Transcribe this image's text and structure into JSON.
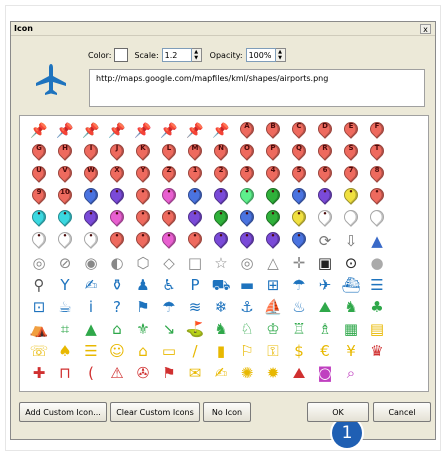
{
  "window": {
    "title": "Icon",
    "close_label": "x"
  },
  "preview": {
    "icon": "airplane-icon",
    "color": "#1e73be"
  },
  "controls": {
    "color_label": "Color:",
    "scale_label": "Scale:",
    "scale_value": "1.2",
    "opacity_label": "Opacity:",
    "opacity_value": "100%"
  },
  "url": "http://maps.google.com/mapfiles/kml/shapes/airports.png",
  "highlight_marker": "1",
  "buttons": {
    "add_custom": "Add Custom Icon...",
    "clear_custom": "Clear Custom Icons",
    "no_icon": "No Icon",
    "ok": "OK",
    "cancel": "Cancel"
  },
  "icons": [
    {
      "t": "push",
      "c": "#e8e800"
    },
    {
      "t": "push",
      "c": "#3a4fd8"
    },
    {
      "t": "push",
      "c": "#2fb13a"
    },
    {
      "t": "push",
      "c": "#22c4c4"
    },
    {
      "t": "push",
      "c": "#d63bd6"
    },
    {
      "t": "push",
      "c": "#7a3fc8"
    },
    {
      "t": "push",
      "c": "#e23232"
    },
    {
      "t": "push",
      "c": "#f2f2f2"
    },
    {
      "t": "pin",
      "c": "#ee6a5e",
      "l": "A"
    },
    {
      "t": "pin",
      "c": "#ee6a5e",
      "l": "B"
    },
    {
      "t": "pin",
      "c": "#ee6a5e",
      "l": "C"
    },
    {
      "t": "pin",
      "c": "#ee6a5e",
      "l": "D"
    },
    {
      "t": "pin",
      "c": "#ee6a5e",
      "l": "E"
    },
    {
      "t": "pin",
      "c": "#ee6a5e",
      "l": "F"
    },
    {
      "t": "pin",
      "c": "#ee6a5e",
      "l": "G"
    },
    {
      "t": "pin",
      "c": "#ee6a5e",
      "l": "H"
    },
    {
      "t": "pin",
      "c": "#ee6a5e",
      "l": "I"
    },
    {
      "t": "pin",
      "c": "#ee6a5e",
      "l": "J"
    },
    {
      "t": "pin",
      "c": "#ee6a5e",
      "l": "K"
    },
    {
      "t": "pin",
      "c": "#ee6a5e",
      "l": "L"
    },
    {
      "t": "pin",
      "c": "#ee6a5e",
      "l": "M"
    },
    {
      "t": "pin",
      "c": "#ee6a5e",
      "l": "N"
    },
    {
      "t": "pin",
      "c": "#ee6a5e",
      "l": "O"
    },
    {
      "t": "pin",
      "c": "#ee6a5e",
      "l": "P"
    },
    {
      "t": "pin",
      "c": "#ee6a5e",
      "l": "Q"
    },
    {
      "t": "pin",
      "c": "#ee6a5e",
      "l": "R"
    },
    {
      "t": "pin",
      "c": "#ee6a5e",
      "l": "S"
    },
    {
      "t": "pin",
      "c": "#ee6a5e",
      "l": "T"
    },
    {
      "t": "pin",
      "c": "#ee6a5e",
      "l": "U"
    },
    {
      "t": "pin",
      "c": "#ee6a5e",
      "l": "V"
    },
    {
      "t": "pin",
      "c": "#ee6a5e",
      "l": "W"
    },
    {
      "t": "pin",
      "c": "#ee6a5e",
      "l": "X"
    },
    {
      "t": "pin",
      "c": "#ee6a5e",
      "l": "Y"
    },
    {
      "t": "pin",
      "c": "#ee6a5e",
      "l": "Z"
    },
    {
      "t": "pin",
      "c": "#ee6a5e",
      "l": "1"
    },
    {
      "t": "pin",
      "c": "#ee6a5e",
      "l": "2"
    },
    {
      "t": "pin",
      "c": "#ee6a5e",
      "l": "3"
    },
    {
      "t": "pin",
      "c": "#ee6a5e",
      "l": "4"
    },
    {
      "t": "pin",
      "c": "#ee6a5e",
      "l": "5"
    },
    {
      "t": "pin",
      "c": "#ee6a5e",
      "l": "6"
    },
    {
      "t": "pin",
      "c": "#ee6a5e",
      "l": "7"
    },
    {
      "t": "pin",
      "c": "#ee6a5e",
      "l": "8"
    },
    {
      "t": "pin",
      "c": "#ee6a5e",
      "l": "9"
    },
    {
      "t": "pin",
      "c": "#ee6a5e",
      "l": "10"
    },
    {
      "t": "pin",
      "c": "#4a73e0",
      "l": "•"
    },
    {
      "t": "pin",
      "c": "#7a4ad8",
      "l": "•"
    },
    {
      "t": "pin",
      "c": "#ee6a5e",
      "l": "•"
    },
    {
      "t": "pin",
      "c": "#e85fd0",
      "l": "•"
    },
    {
      "t": "pin",
      "c": "#4a73e0",
      "l": "•"
    },
    {
      "t": "pin",
      "c": "#7a4ad8",
      "l": "•"
    },
    {
      "t": "pin",
      "c": "#5ef08c",
      "l": "•"
    },
    {
      "t": "pin",
      "c": "#2fb13a",
      "l": "•"
    },
    {
      "t": "pin",
      "c": "#4a73e0",
      "l": "•"
    },
    {
      "t": "pin",
      "c": "#7a4ad8",
      "l": "•"
    },
    {
      "t": "pin",
      "c": "#f0e040",
      "l": "•"
    },
    {
      "t": "pin",
      "c": "#ee6a5e",
      "l": "•"
    },
    {
      "t": "pin",
      "c": "#3ad8e0",
      "l": "•"
    },
    {
      "t": "pin",
      "c": "#3ad8e0",
      "l": "•"
    },
    {
      "t": "pin",
      "c": "#7a4ad8",
      "l": "•"
    },
    {
      "t": "pin",
      "c": "#e85fd0",
      "l": "•"
    },
    {
      "t": "pin",
      "c": "#ee6a5e",
      "l": "•"
    },
    {
      "t": "pin",
      "c": "#ee6a5e",
      "l": "•"
    },
    {
      "t": "pin",
      "c": "#7a4ad8",
      "l": "•"
    },
    {
      "t": "pin",
      "c": "#2fb13a",
      "l": "•"
    },
    {
      "t": "pin",
      "c": "#4a73e0",
      "l": "•"
    },
    {
      "t": "pin",
      "c": "#2fb13a",
      "l": "•"
    },
    {
      "t": "pin",
      "c": "#f0e040",
      "l": "•"
    },
    {
      "t": "pin",
      "c": "#ffffff",
      "l": "•"
    },
    {
      "t": "pin",
      "c": "#ffffff",
      "l": ""
    },
    {
      "t": "pin",
      "c": "#ffffff",
      "l": ""
    },
    {
      "t": "pin",
      "c": "#ffffff",
      "l": "•"
    },
    {
      "t": "pin",
      "c": "#ffffff",
      "l": "•"
    },
    {
      "t": "pin",
      "c": "#ffffff",
      "l": "•"
    },
    {
      "t": "pin",
      "c": "#ee6a5e",
      "l": "•"
    },
    {
      "t": "pin",
      "c": "#ee6a5e",
      "l": "•"
    },
    {
      "t": "pin",
      "c": "#e85fd0",
      "l": "•"
    },
    {
      "t": "pin",
      "c": "#ee6a5e",
      "l": "•"
    },
    {
      "t": "pin",
      "c": "#7a4ad8",
      "l": "•"
    },
    {
      "t": "pin",
      "c": "#7a4ad8",
      "l": "•"
    },
    {
      "t": "pin",
      "c": "#7a4ad8",
      "l": "•"
    },
    {
      "t": "pin",
      "c": "#4a73e0",
      "l": "•"
    },
    {
      "t": "sym",
      "s": "⟳",
      "c": "#777"
    },
    {
      "t": "sym",
      "s": "⇩",
      "c": "#777"
    },
    {
      "t": "sym",
      "s": "▲",
      "c": "#3a6ac8"
    },
    {
      "t": "sym",
      "s": "◎",
      "c": "#888"
    },
    {
      "t": "sym",
      "s": "⊘",
      "c": "#888"
    },
    {
      "t": "sym",
      "s": "◉",
      "c": "#888"
    },
    {
      "t": "sym",
      "s": "◐",
      "c": "#888"
    },
    {
      "t": "sym",
      "s": "⬡",
      "c": "#888"
    },
    {
      "t": "sym",
      "s": "◇",
      "c": "#888"
    },
    {
      "t": "sym",
      "s": "□",
      "c": "#888"
    },
    {
      "t": "sym",
      "s": "☆",
      "c": "#888"
    },
    {
      "t": "sym",
      "s": "◎",
      "c": "#888"
    },
    {
      "t": "sym",
      "s": "△",
      "c": "#888"
    },
    {
      "t": "sym",
      "s": "✛",
      "c": "#888"
    },
    {
      "t": "sym",
      "s": "▣",
      "c": "#222"
    },
    {
      "t": "sym",
      "s": "⊙",
      "c": "#222"
    },
    {
      "t": "sym",
      "s": "●",
      "c": "#aaa"
    },
    {
      "t": "sym",
      "s": "⚲",
      "c": "#555"
    },
    {
      "t": "sym",
      "s": "Y",
      "c": "#1e73be"
    },
    {
      "t": "sym",
      "s": "✍",
      "c": "#1e73be"
    },
    {
      "t": "sym",
      "s": "⚱",
      "c": "#1e73be"
    },
    {
      "t": "sym",
      "s": "♟",
      "c": "#1e73be"
    },
    {
      "t": "sym",
      "s": "♿",
      "c": "#1e73be"
    },
    {
      "t": "sym",
      "s": "P",
      "c": "#1e73be"
    },
    {
      "t": "sym",
      "s": "⛟",
      "c": "#1e73be"
    },
    {
      "t": "sym",
      "s": "▬",
      "c": "#1e73be"
    },
    {
      "t": "sym",
      "s": "⊞",
      "c": "#1e73be"
    },
    {
      "t": "sym",
      "s": "☂",
      "c": "#1e73be"
    },
    {
      "t": "sym",
      "s": "✈",
      "c": "#1e73be"
    },
    {
      "t": "sym",
      "s": "⛴",
      "c": "#1e73be"
    },
    {
      "t": "sym",
      "s": "☰",
      "c": "#1e73be"
    },
    {
      "t": "sym",
      "s": "⊡",
      "c": "#1e73be"
    },
    {
      "t": "sym",
      "s": "☕",
      "c": "#1e73be"
    },
    {
      "t": "sym",
      "s": "i",
      "c": "#1e73be"
    },
    {
      "t": "sym",
      "s": "?",
      "c": "#1e73be"
    },
    {
      "t": "sym",
      "s": "⚑",
      "c": "#1e73be"
    },
    {
      "t": "sym",
      "s": "☂",
      "c": "#1e73be"
    },
    {
      "t": "sym",
      "s": "≋",
      "c": "#1e73be"
    },
    {
      "t": "sym",
      "s": "❄",
      "c": "#1e73be"
    },
    {
      "t": "sym",
      "s": "⚓",
      "c": "#1e73be"
    },
    {
      "t": "sym",
      "s": "⛵",
      "c": "#1e73be"
    },
    {
      "t": "sym",
      "s": "♨",
      "c": "#1e73be"
    },
    {
      "t": "sym",
      "s": "⛰",
      "c": "#2fa84a"
    },
    {
      "t": "sym",
      "s": "♞",
      "c": "#2fa84a"
    },
    {
      "t": "sym",
      "s": "♣",
      "c": "#2fa84a"
    },
    {
      "t": "sym",
      "s": "⛺",
      "c": "#2fa84a"
    },
    {
      "t": "sym",
      "s": "⌗",
      "c": "#2fa84a"
    },
    {
      "t": "sym",
      "s": "▲",
      "c": "#2fa84a"
    },
    {
      "t": "sym",
      "s": "⌂",
      "c": "#2fa84a"
    },
    {
      "t": "sym",
      "s": "⚜",
      "c": "#2fa84a"
    },
    {
      "t": "sym",
      "s": "↘",
      "c": "#2fa84a"
    },
    {
      "t": "sym",
      "s": "⛳",
      "c": "#2fa84a"
    },
    {
      "t": "sym",
      "s": "♞",
      "c": "#2fa84a"
    },
    {
      "t": "sym",
      "s": "♘",
      "c": "#2fa84a"
    },
    {
      "t": "sym",
      "s": "♔",
      "c": "#2fa84a"
    },
    {
      "t": "sym",
      "s": "♖",
      "c": "#2fa84a"
    },
    {
      "t": "sym",
      "s": "♗",
      "c": "#2fa84a"
    },
    {
      "t": "sym",
      "s": "▦",
      "c": "#2fa84a"
    },
    {
      "t": "sym",
      "s": "▤",
      "c": "#e8b800"
    },
    {
      "t": "sym",
      "s": "☏",
      "c": "#e8b800"
    },
    {
      "t": "sym",
      "s": "♠",
      "c": "#e8b800"
    },
    {
      "t": "sym",
      "s": "☰",
      "c": "#e8b800"
    },
    {
      "t": "sym",
      "s": "☺",
      "c": "#e8b800"
    },
    {
      "t": "sym",
      "s": "⌂",
      "c": "#e8b800"
    },
    {
      "t": "sym",
      "s": "▭",
      "c": "#e8b800"
    },
    {
      "t": "sym",
      "s": "/",
      "c": "#e8b800"
    },
    {
      "t": "sym",
      "s": "▮",
      "c": "#e8b800"
    },
    {
      "t": "sym",
      "s": "⚐",
      "c": "#e8b800"
    },
    {
      "t": "sym",
      "s": "⚿",
      "c": "#e8b800"
    },
    {
      "t": "sym",
      "s": "$",
      "c": "#e8b800"
    },
    {
      "t": "sym",
      "s": "€",
      "c": "#e8b800"
    },
    {
      "t": "sym",
      "s": "¥",
      "c": "#e8b800"
    },
    {
      "t": "sym",
      "s": "♛",
      "c": "#d03030"
    },
    {
      "t": "sym",
      "s": "✚",
      "c": "#d03030"
    },
    {
      "t": "sym",
      "s": "⊓",
      "c": "#d03030"
    },
    {
      "t": "sym",
      "s": "(",
      "c": "#d03030"
    },
    {
      "t": "sym",
      "s": "⚠",
      "c": "#d03030"
    },
    {
      "t": "sym",
      "s": "✇",
      "c": "#d03030"
    },
    {
      "t": "sym",
      "s": "⚑",
      "c": "#d03030"
    },
    {
      "t": "sym",
      "s": "✉",
      "c": "#e8b800"
    },
    {
      "t": "sym",
      "s": "✍",
      "c": "#e8b800"
    },
    {
      "t": "sym",
      "s": "✺",
      "c": "#e8b800"
    },
    {
      "t": "sym",
      "s": "✹",
      "c": "#e8b800"
    },
    {
      "t": "sym",
      "s": "⛰",
      "c": "#d03030"
    },
    {
      "t": "sym",
      "s": "◙",
      "c": "#c040c0"
    },
    {
      "t": "sym",
      "s": "⌕",
      "c": "#c040c0"
    }
  ]
}
